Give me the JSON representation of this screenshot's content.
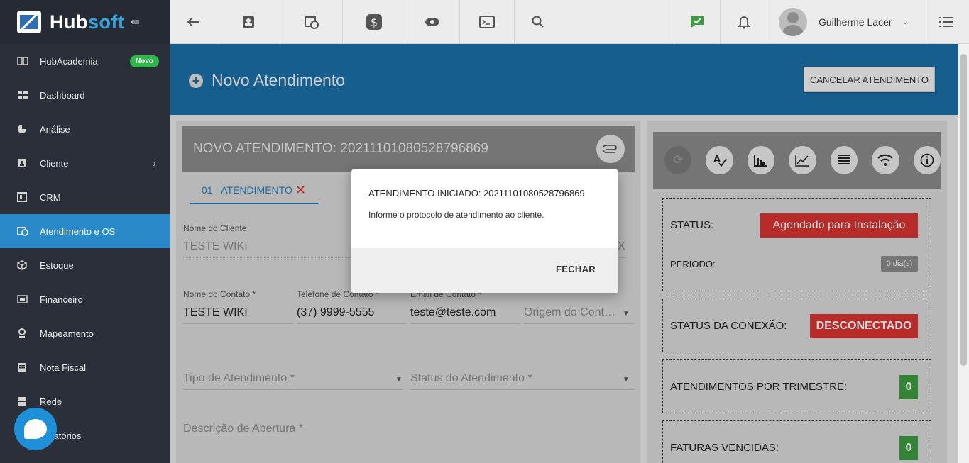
{
  "app": {
    "logo_hub": "Hub",
    "logo_soft": "soft",
    "collapse_icon": "⇚"
  },
  "sidebar": {
    "items": [
      {
        "label": "HubAcademia",
        "icon": "book-icon",
        "badge": "Novo"
      },
      {
        "label": "Dashboard",
        "icon": "grid-icon"
      },
      {
        "label": "Análise",
        "icon": "pie-chart-icon"
      },
      {
        "label": "Cliente",
        "icon": "contact-card-icon",
        "chevron": "›"
      },
      {
        "label": "CRM",
        "icon": "board-icon"
      },
      {
        "label": "Atendimento e OS",
        "icon": "calendar-clock-icon",
        "active": true
      },
      {
        "label": "Estoque",
        "icon": "box-icon"
      },
      {
        "label": "Financeiro",
        "icon": "money-icon"
      },
      {
        "label": "Mapeamento",
        "icon": "map-pin-icon"
      },
      {
        "label": "Nota Fiscal",
        "icon": "document-icon"
      },
      {
        "label": "Rede",
        "icon": "server-icon"
      },
      {
        "label": "Relatórios",
        "icon": "report-icon"
      }
    ]
  },
  "topbar": {
    "icons": [
      "back-arrow-icon",
      "contact-icon",
      "calendar-clock-icon",
      "dollar-icon",
      "eye-icon",
      "terminal-icon",
      "search-icon",
      "check-message-icon",
      "bell-icon",
      "list-menu-icon"
    ],
    "user_name": "Guilherme Lacer",
    "caret": "⌄"
  },
  "page": {
    "title": "Novo Atendimento",
    "cancel_label": "CANCELAR ATENDIMENTO"
  },
  "form": {
    "card_title": "NOVO ATENDIMENTO: 20211101080528796869",
    "tab_label": "01 - ATENDIMENTO",
    "tab_close": "✕",
    "cliente_label": "Nome do Cliente",
    "cliente_value": "TESTE WIKI",
    "cliente_clear": "X",
    "contato_label": "Nome do Contato *",
    "contato_value": "TESTE WIKI",
    "telefone_label": "Telefone de Contato *",
    "telefone_value": "(37) 9999-5555",
    "email_label": "Email de Contato *",
    "email_value": "teste@teste.com",
    "origem_placeholder": "Origem do Cont…",
    "tipo_placeholder": "Tipo de Atendimento *",
    "status_placeholder": "Status do Atendimento *",
    "descricao_placeholder": "Descrição de Abertura *"
  },
  "status_panel": {
    "icons": [
      "refresh-icon",
      "spellcheck-icon",
      "bar-chart-icon",
      "line-chart-icon",
      "list-lines-icon",
      "wifi-icon",
      "info-icon"
    ],
    "status_label": "STATUS:",
    "status_value": "Agendado para Instalação",
    "periodo_label": "PERÍODO:",
    "periodo_value": "0 dia(s)",
    "conexao_label": "STATUS DA CONEXÃO:",
    "conexao_value": "DESCONECTADO",
    "trimestre_label": "ATENDIMENTOS POR TRIMESTRE:",
    "trimestre_value": "0",
    "faturas_label": "FATURAS VENCIDAS:",
    "faturas_value": "0"
  },
  "modal": {
    "title": "ATENDIMENTO INICIADO: 20211101080528796869",
    "body": "Informe o protocolo de atendimento ao cliente.",
    "close_label": "FECHAR"
  }
}
